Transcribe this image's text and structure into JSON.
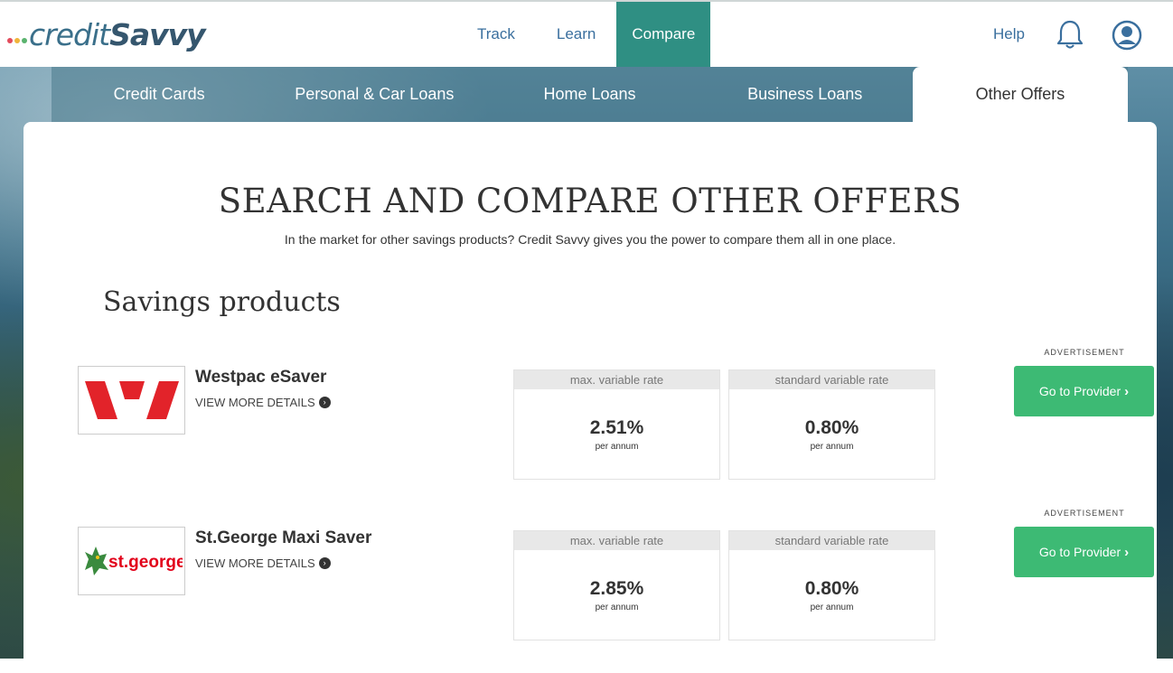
{
  "logo": {
    "text_light": "credit",
    "text_bold": "Savvy",
    "dot_colors": [
      "#e34b5c",
      "#f0b43a",
      "#5ab36e"
    ]
  },
  "nav": {
    "items": [
      {
        "label": "Track"
      },
      {
        "label": "Learn"
      },
      {
        "label": "Compare"
      }
    ],
    "active": "Compare",
    "help_label": "Help"
  },
  "subnav": {
    "items": [
      {
        "label": "Credit Cards"
      },
      {
        "label": "Personal & Car Loans"
      },
      {
        "label": "Home Loans"
      },
      {
        "label": "Business Loans"
      },
      {
        "label": "Other Offers"
      }
    ],
    "active": "Other Offers"
  },
  "page": {
    "title": "SEARCH AND COMPARE OTHER OFFERS",
    "subtitle": "In the market for other savings products? Credit Savvy gives you the power to compare them all in one place.",
    "section_title": "Savings products"
  },
  "offers": [
    {
      "ad_label": "ADVERTISEMENT",
      "name": "Westpac eSaver",
      "logo": "westpac-logo",
      "more_label": "VIEW MORE DETAILS",
      "max_label": "max. variable rate",
      "max_rate": "2.51%",
      "max_unit": "per annum",
      "std_label": "standard variable rate",
      "std_rate": "0.80%",
      "std_unit": "per annum",
      "button_label": "Go to Provider"
    },
    {
      "ad_label": "ADVERTISEMENT",
      "name": "St.George Maxi Saver",
      "logo": "stgeorge-logo",
      "logo_text": "st.george",
      "more_label": "VIEW MORE DETAILS",
      "max_label": "max. variable rate",
      "max_rate": "2.85%",
      "max_unit": "per annum",
      "std_label": "standard variable rate",
      "std_rate": "0.80%",
      "std_unit": "per annum",
      "button_label": "Go to Provider"
    }
  ],
  "colors": {
    "accent": "#2f8f83",
    "button": "#3dba74",
    "link": "#3a6f9e",
    "westpac_red": "#e2232a",
    "stgeorge_red": "#e2001a",
    "stgeorge_green": "#3a8a3e"
  }
}
